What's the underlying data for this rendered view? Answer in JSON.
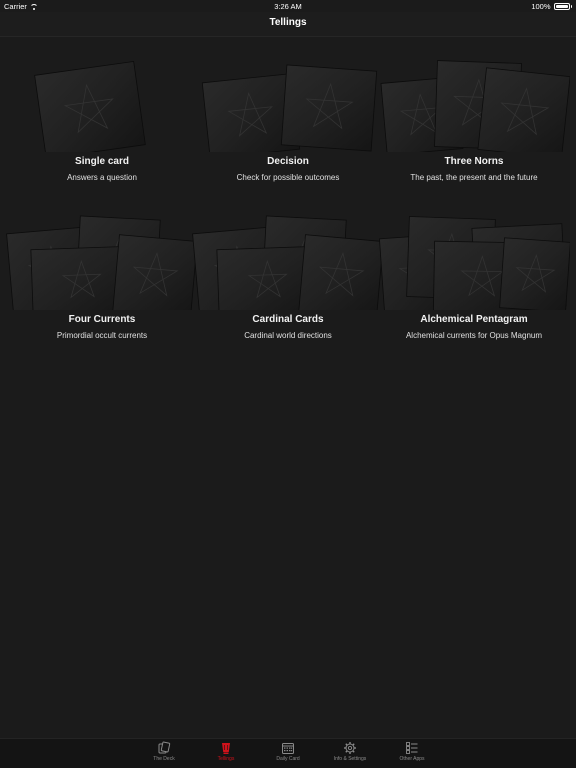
{
  "status": {
    "carrier": "Carrier",
    "time": "3:26 AM",
    "battery": "100%"
  },
  "nav": {
    "title": "Tellings"
  },
  "tellings": [
    {
      "name": "Single card",
      "desc": "Answers a question",
      "cards": 1
    },
    {
      "name": "Decision",
      "desc": "Check for possible outcomes",
      "cards": 2
    },
    {
      "name": "Three Norns",
      "desc": "The past, the present and the future",
      "cards": 3
    },
    {
      "name": "Four Currents",
      "desc": "Primordial occult currents",
      "cards": 4
    },
    {
      "name": "Cardinal Cards",
      "desc": "Cardinal world directions",
      "cards": 4
    },
    {
      "name": "Alchemical Pentagram",
      "desc": "Alchemical currents for Opus Magnum",
      "cards": 5
    }
  ],
  "tabs": [
    {
      "label": "The Deck",
      "icon": "cards-icon",
      "active": false
    },
    {
      "label": "Tellings",
      "icon": "cup-icon",
      "active": true
    },
    {
      "label": "Daily Card",
      "icon": "calendar-icon",
      "active": false
    },
    {
      "label": "Info & Settings",
      "icon": "gear-icon",
      "active": false
    },
    {
      "label": "Other Apps",
      "icon": "apps-list-icon",
      "active": false
    }
  ],
  "colors": {
    "background": "#1b1b1b",
    "accent": "#d0121b",
    "tab_inactive": "#8a8a8a"
  }
}
